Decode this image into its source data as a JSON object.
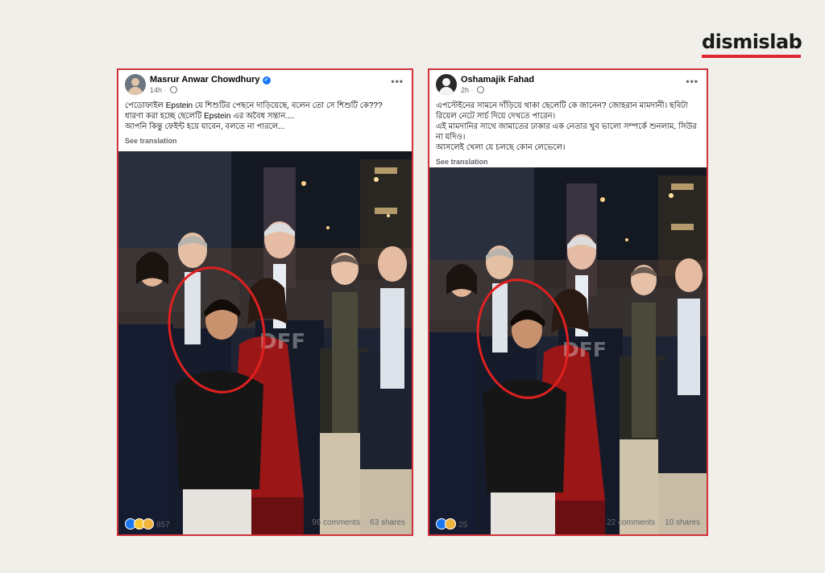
{
  "brand": {
    "logo_text": "dismislab",
    "accent": "#e0262f"
  },
  "posts": [
    {
      "author": "Masrur Anwar Chowdhury",
      "verified": true,
      "time": "14h",
      "lines": [
        "পেডোফাইল Epstein যে শিশুটির পেছনে দাড়িয়েছে, বলেন তো সে শিশুটি কে???",
        "ধারণা করা হচ্ছে ছেলেটি Epstein এর অবৈধ সন্তান....",
        "আপনি কিন্তু ফেইন্ট হয়ে যাবেন, বলতে না পারলে..."
      ],
      "see_translation": "See translation",
      "reactions": "857",
      "comments": "96 comments",
      "shares": "63 shares",
      "photo_watermark": "DFF"
    },
    {
      "author": "Oshamajik Fahad",
      "verified": false,
      "time": "2h",
      "lines": [
        "এপস্টেইনের সামনে দাঁড়িয়ে থাকা ছেলেটি কে জানেন? জোহরান মামদানী। ছবিটা রিয়েল নেটে সার্চ দিয়ে দেখতে পারেন।",
        "এই মামদানির সাথে জামাতের ঢাকার এক নেতার খুব ভালো সম্পর্কে শুনলাম, সিউর না যদিও।",
        "আসলেই খেলা যে চলছে কোন লেভেলে।"
      ],
      "see_translation": "See translation",
      "reactions": "25",
      "comments": "22 comments",
      "shares": "10 shares",
      "photo_watermark": "DFF"
    }
  ],
  "colors": {
    "frame": "#d2323a",
    "circle": "#e02020",
    "fb_blue": "#1877f2"
  }
}
